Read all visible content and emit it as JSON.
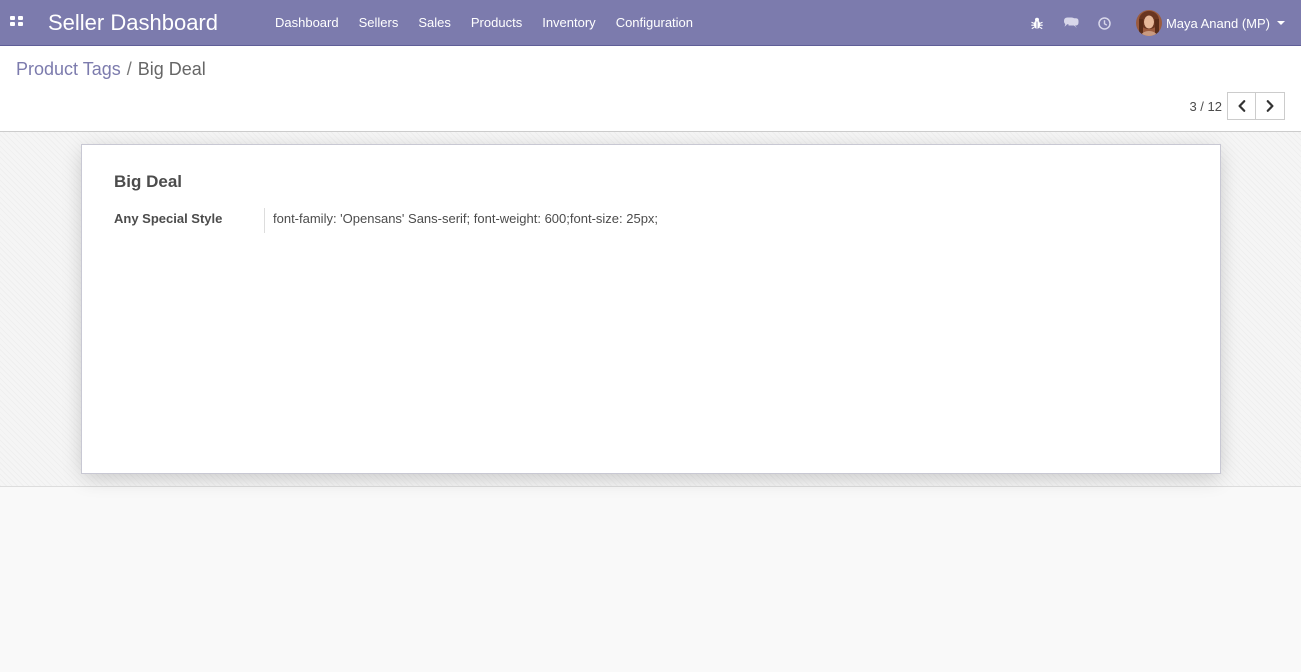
{
  "navbar": {
    "brand": "Seller Dashboard",
    "menu": [
      "Dashboard",
      "Sellers",
      "Sales",
      "Products",
      "Inventory",
      "Configuration"
    ],
    "systray_icons": [
      "bug-icon",
      "chat-icon",
      "clock-icon"
    ],
    "user_name": "Maya Anand (MP)",
    "color": "#7c7bad"
  },
  "breadcrumb": {
    "parent": "Product Tags",
    "separator": "/",
    "current": "Big Deal"
  },
  "pager": {
    "value": "3 / 12",
    "prev_icon": "chevron-left-icon",
    "next_icon": "chevron-right-icon"
  },
  "form": {
    "title": "Big Deal",
    "field_label": "Any Special Style",
    "field_value": "font-family: 'Opensans' Sans-serif; font-weight: 600;font-size: 25px;"
  }
}
